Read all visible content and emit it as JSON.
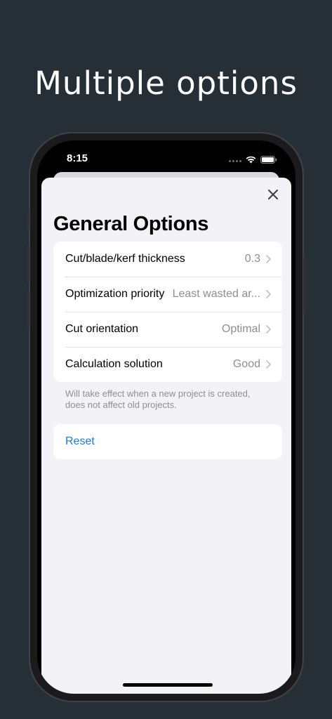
{
  "headline": "Multiple options",
  "status_bar": {
    "time": "8:15",
    "icons": [
      "signal-dots-icon",
      "wifi-icon",
      "battery-icon"
    ]
  },
  "sheet": {
    "title": "General Options",
    "close_icon": "close-icon",
    "options": [
      {
        "label": "Cut/blade/kerf thickness",
        "value": "0.3"
      },
      {
        "label": "Optimization priority",
        "value": "Least wasted ar..."
      },
      {
        "label": "Cut orientation",
        "value": "Optimal"
      },
      {
        "label": "Calculation solution",
        "value": "Good"
      }
    ],
    "footnote": "Will take effect when a new project is created, does not affect old projects.",
    "reset_label": "Reset"
  },
  "colors": {
    "background": "#262f35",
    "sheet": "#f2f2f7",
    "accent": "#1a7ce8",
    "secondary_text": "#8e8e93"
  }
}
